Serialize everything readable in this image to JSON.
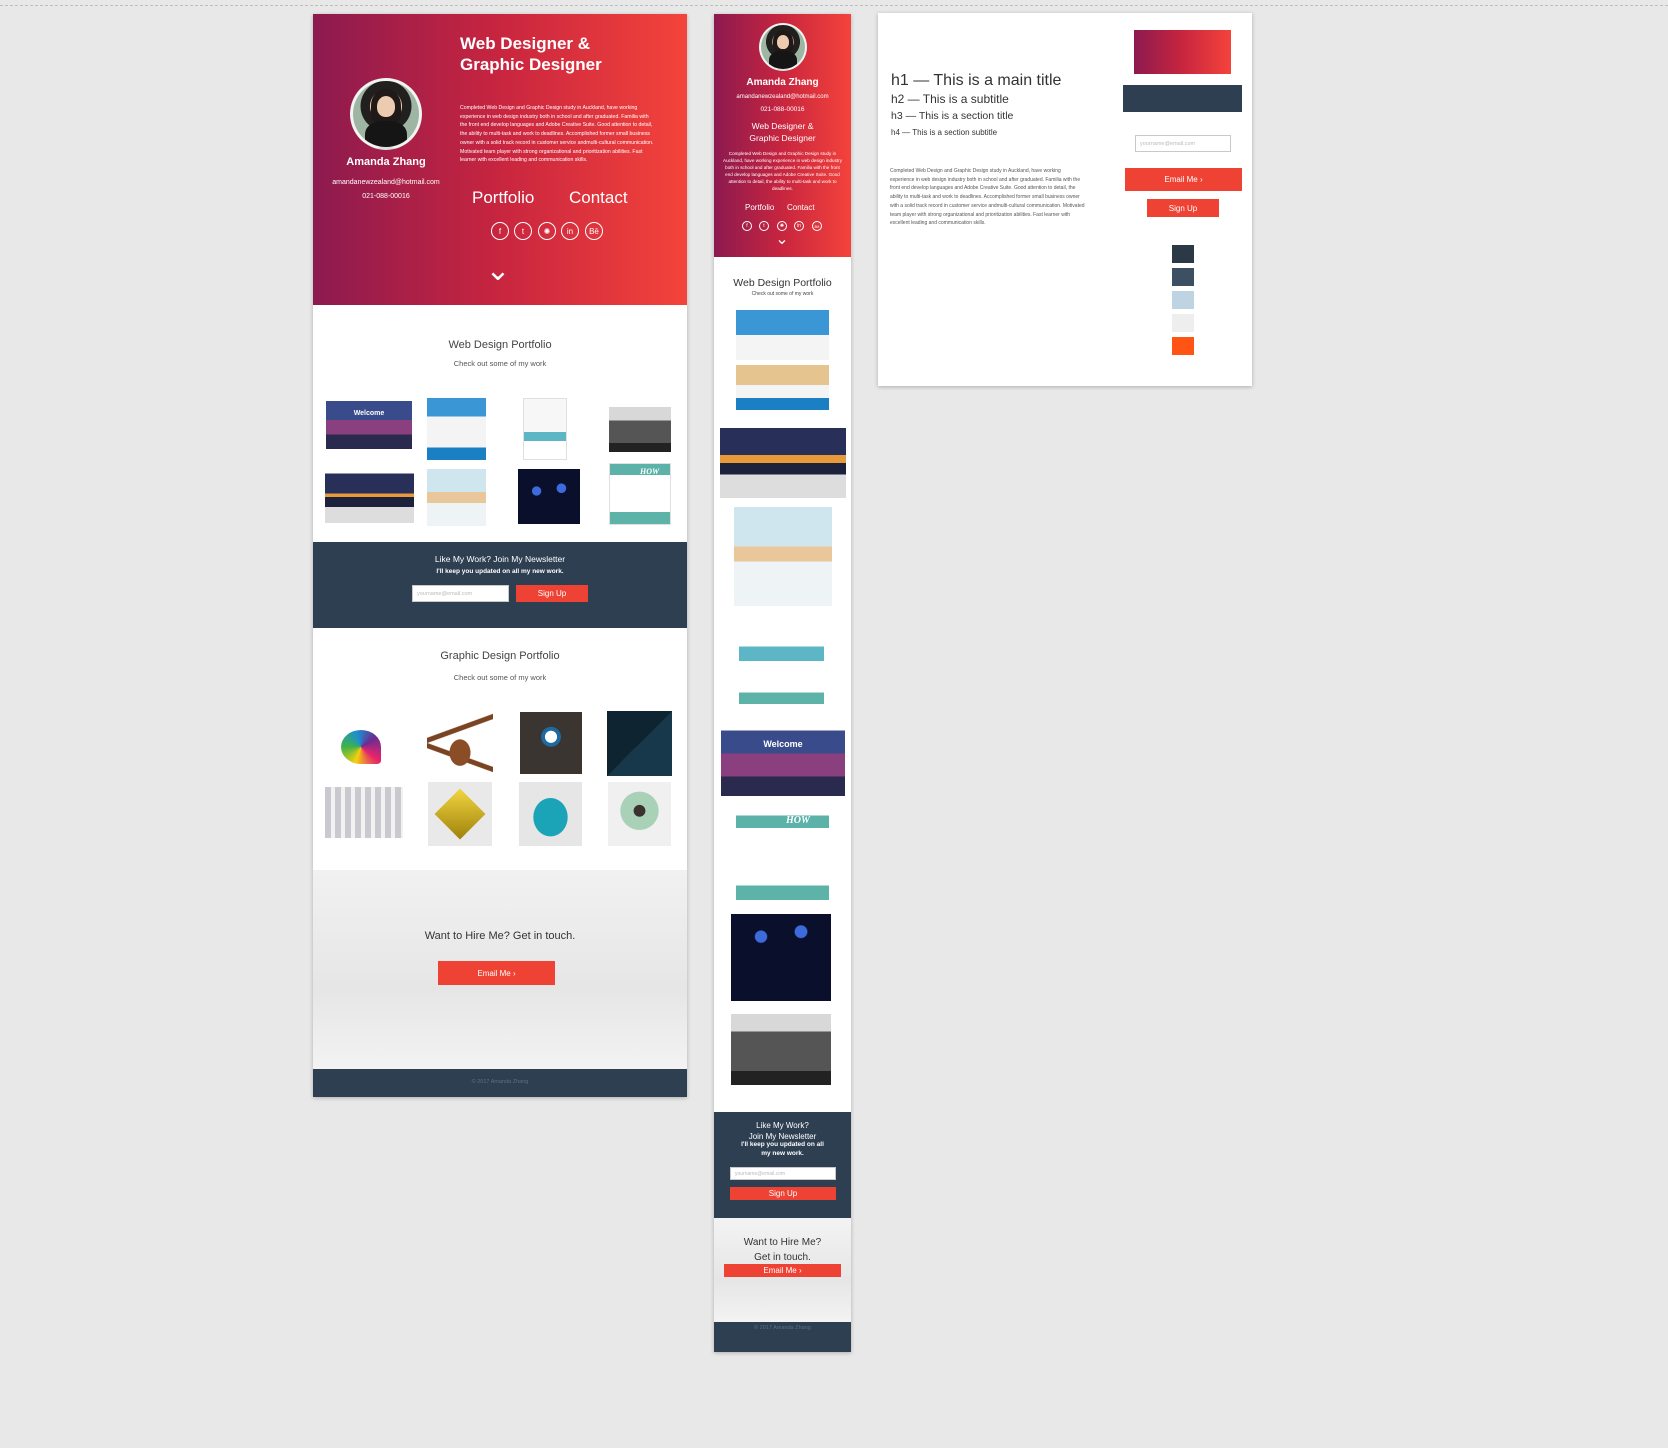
{
  "colors": {
    "accent_red": "#ee4334",
    "gradient_start": "#8c1a4f",
    "gradient_end": "#f4433b",
    "navy": "#2e3f52"
  },
  "desktop": {
    "hero": {
      "title_line1": "Web Designer &",
      "title_line2": "Graphic Designer",
      "name": "Amanda Zhang",
      "email": "amandanewzealand@hotmail.com",
      "phone": "021-088-00016",
      "bio": "Completed Web Design and Graphic Design study in Auckland, have working experience in web design industry both in school and after graduated. Familia with the front end develop languages and Adobe Creative Suite. Good attention to detail, the ability to multi-task and work to deadlines. Accomplished former small business owner with a solid track record in customer service andmulti-cultural communication. Motivated team player with strong organizational and prioritization abilities. Fast learner with excellent leading and communication skills.",
      "nav_portfolio": "Portfolio",
      "nav_contact": "Contact",
      "social_icons": [
        "facebook-icon",
        "twitter-icon",
        "dribbble-icon",
        "linkedin-icon",
        "behance-icon"
      ],
      "social_glyphs": [
        "f",
        "t",
        "✺",
        "in",
        "Bē"
      ],
      "scroll_glyph": "⌄"
    },
    "web_portfolio": {
      "title": "Web Design Portfolio",
      "subtitle": "Check out some of my work",
      "welcome_text": "Welcome",
      "how_text": "HOW"
    },
    "newsletter": {
      "title": "Like My Work? Join My Newsletter",
      "subtitle": "I'll keep you updated on all my new work.",
      "placeholder": "yourname@email.com",
      "button": "Sign Up"
    },
    "graphic_portfolio": {
      "title": "Graphic Design Portfolio",
      "subtitle": "Check out some of my work"
    },
    "hire": {
      "title": "Want to Hire Me? Get in touch.",
      "button": "Email Me ›"
    },
    "footer": {
      "copyright": "© 2017 Amanda Zhang"
    }
  },
  "mobile": {
    "name": "Amanda Zhang",
    "email": "amandanewzealand@hotmail.com",
    "phone": "021-088-00016",
    "title_line1": "Web Designer &",
    "title_line2": "Graphic Designer",
    "bio": "Completed Web Design and Graphic Design study in Auckland, have working experience in web design industry both in school and after graduated. Familia with the front end develop languages and Adobe Creative Suite. Good attention to detail, the ability to multi-task and work to deadlines.",
    "nav_portfolio": "Portfolio",
    "nav_contact": "Contact",
    "social_glyphs": [
      "f",
      "t",
      "✺",
      "in",
      "Bē"
    ],
    "scroll_glyph": "⌄",
    "web_title": "Web Design Portfolio",
    "web_subtitle": "Check out some of my work",
    "welcome_text": "Welcome",
    "how_text": "HOW",
    "newsletter_line1": "Like My Work?",
    "newsletter_line2": "Join My Newsletter",
    "newsletter_line3": "I'll keep you updated on all",
    "newsletter_line4": "my new work.",
    "placeholder": "yourname@email.com",
    "signup": "Sign Up",
    "hire_line1": "Want to Hire Me?",
    "hire_line2": "Get in touch.",
    "email_button": "Email Me ›",
    "copyright": "© 2017 Amanda Zhang"
  },
  "styleguide": {
    "h1": "h1 — This is a main title",
    "h2": "h2 — This is a subtitle",
    "h3": "h3 — This is a section title",
    "h4": "h4 — This is a section subtitle",
    "body_text": "Completed Web Design and Graphic Design study in Auckland, have working experience in web design industry both in school and after graduated. Familia with the front end develop languages and Adobe Creative Suite. Good attention to detail, the ability to multi-task and work to deadlines. Accomplished former small business owner with a solid track record in customer service andmulti-cultural communication. Motivated team player with strong organizational and prioritization abilities. Fast learner with excellent leading and communication skills.",
    "input_placeholder": "yourname@email.com",
    "email_button": "Email Me ›",
    "signup_button": "Sign Up",
    "swatches": [
      "#2b3846",
      "#3d5063",
      "#bfd4e3",
      "#eeeeee",
      "#ff5414"
    ]
  }
}
